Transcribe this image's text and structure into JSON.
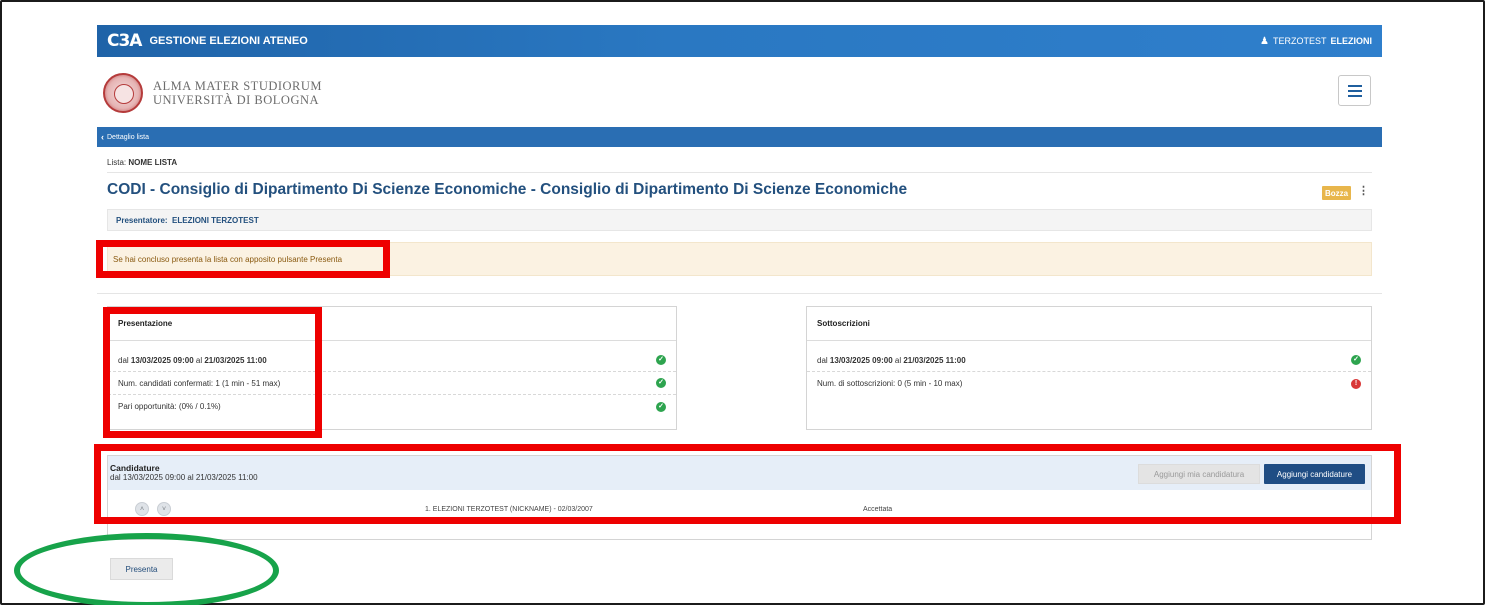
{
  "topbar": {
    "logo": "C3A",
    "app_name": "GESTIONE ELEZIONI ATENEO",
    "user_first": "TERZOTEST",
    "user_last": "ELEZIONI",
    "user_icon": "user-icon"
  },
  "brand": {
    "line1": "ALMA MATER STUDIORUM",
    "line2": "UNIVERSITÀ DI BOLOGNA",
    "menu_icon": "hamburger-icon"
  },
  "nav": {
    "back_label": "Dettaglio lista",
    "back_icon": "chevron-left-icon"
  },
  "lista": {
    "prefix": "Lista:",
    "name": "NOME LISTA"
  },
  "page_title": "CODI - Consiglio di Dipartimento Di Scienze Economiche - Consiglio di Dipartimento Di Scienze Economiche",
  "status_badge": "Bozza",
  "presentatore": {
    "label": "Presentatore:",
    "value": "ELEZIONI TERZOTEST"
  },
  "alert_text": "Se hai concluso presenta la lista con apposito pulsante Presenta",
  "presentazione": {
    "title": "Presentazione",
    "date_prefix": "dal",
    "date_from": "13/03/2025 09:00",
    "date_mid": "al",
    "date_to": "21/03/2025 11:00",
    "row2": "Num. candidati confermati: 1 (1 min - 51 max)",
    "row3": "Pari opportunità: (0% / 0.1%)"
  },
  "sottoscrizioni": {
    "title": "Sottoscrizioni",
    "date_prefix": "dal",
    "date_from": "13/03/2025 09:00",
    "date_mid": "al",
    "date_to": "21/03/2025 11:00",
    "row2": "Num. di sottoscrizioni: 0 (5 min - 10 max)"
  },
  "candidature": {
    "title": "Candidature",
    "period": "dal 13/03/2025 09:00 al 21/03/2025 11:00",
    "btn_mine": "Aggiungi mia candidatura",
    "btn_add": "Aggiungi candidature",
    "rows": [
      {
        "name": "1. ELEZIONI TERZOTEST (NICKNAME) - 02/03/2007",
        "status": "Accettata"
      }
    ]
  },
  "presenta_button": "Presenta",
  "colors": {
    "topbar": "#2a78c2",
    "title": "#23507e",
    "badge": "#e8b64c",
    "ok": "#2ea44f",
    "error": "#d93636",
    "highlight": "#ee0000",
    "ring": "#17a34a"
  }
}
